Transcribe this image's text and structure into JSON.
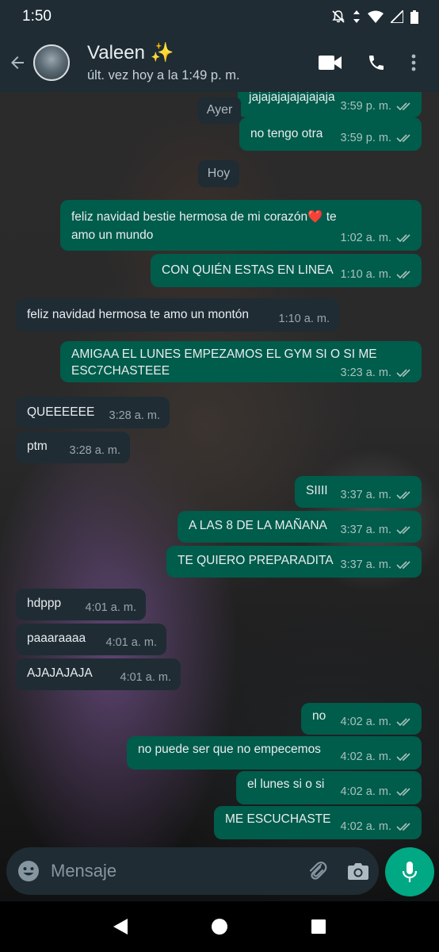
{
  "status_bar": {
    "time": "1:50"
  },
  "header": {
    "contact_name": "Valeen ✨",
    "last_seen": "últ. vez hoy a la 1:49 p. m."
  },
  "day_chips": {
    "yesterday": "Ayer",
    "today": "Hoy"
  },
  "messages": [
    {
      "direction": "out",
      "text": "jajajajajajajajaja",
      "time": "3:59 p. m.",
      "status": "read"
    },
    {
      "direction": "out",
      "text": "no tengo otra",
      "time": "3:59 p. m.",
      "status": "read"
    },
    {
      "direction": "out",
      "text": "feliz navidad bestie hermosa de mi corazón❤️ te amo un mundo",
      "time": "1:02 a. m.",
      "status": "read"
    },
    {
      "direction": "out",
      "text": "CON QUIÉN ESTAS EN LINEA",
      "time": "1:10 a. m.",
      "status": "read"
    },
    {
      "direction": "in",
      "text": "feliz navidad hermosa te amo un montón",
      "time": "1:10 a. m."
    },
    {
      "direction": "out",
      "text": "AMIGAA EL LUNES EMPEZAMOS EL GYM SI O SI ME ESC7CHASTEEE",
      "time": "3:23 a. m.",
      "status": "read"
    },
    {
      "direction": "in",
      "text": "QUEEEEEE",
      "time": "3:28 a. m."
    },
    {
      "direction": "in",
      "text": "ptm",
      "time": "3:28 a. m."
    },
    {
      "direction": "out",
      "text": "SIIII",
      "time": "3:37 a. m.",
      "status": "read"
    },
    {
      "direction": "out",
      "text": "A LAS 8 DE LA MAÑANA",
      "time": "3:37 a. m.",
      "status": "read"
    },
    {
      "direction": "out",
      "text": "TE QUIERO PREPARADITA",
      "time": "3:37 a. m.",
      "status": "read"
    },
    {
      "direction": "in",
      "text": "hdppp",
      "time": "4:01 a. m."
    },
    {
      "direction": "in",
      "text": "paaaraaaa",
      "time": "4:01 a. m."
    },
    {
      "direction": "in",
      "text": "AJAJAJAJA",
      "time": "4:01 a. m."
    },
    {
      "direction": "out",
      "text": "no",
      "time": "4:02 a. m.",
      "status": "read"
    },
    {
      "direction": "out",
      "text": "no puede ser que no empecemos",
      "time": "4:02 a. m.",
      "status": "read"
    },
    {
      "direction": "out",
      "text": "el lunes si o si",
      "time": "4:02 a. m.",
      "status": "read"
    },
    {
      "direction": "out",
      "text": "ME ESCUCHASTE",
      "time": "4:02 a. m.",
      "status": "read"
    }
  ],
  "input": {
    "placeholder": "Mensaje"
  },
  "colors": {
    "outgoing_bubble": "#005c4b",
    "incoming_bubble": "#1f2c34",
    "header": "#1f2c34",
    "accent": "#00a884",
    "read_ticks": "#a9c3bd"
  },
  "icons": {
    "header": [
      "back-arrow-icon",
      "video-call-icon",
      "phone-icon",
      "more-vert-icon"
    ],
    "status": [
      "dnd-icon",
      "data-arrows-icon",
      "wifi-icon",
      "signal-icon",
      "battery-icon"
    ],
    "input": [
      "emoji-icon",
      "attach-icon",
      "camera-icon",
      "mic-icon"
    ],
    "nav": [
      "back-triangle-icon",
      "home-circle-icon",
      "recents-square-icon"
    ]
  }
}
